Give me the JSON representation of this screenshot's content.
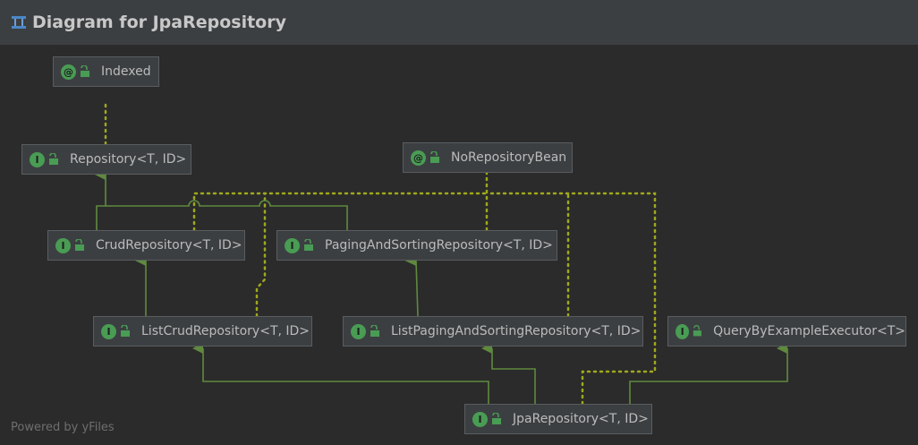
{
  "title": "Diagram for JpaRepository",
  "footer": "Powered by yFiles",
  "colors": {
    "edge": "#5f8a3e",
    "annotation_edge": "#a0a81c",
    "icon": "#499c54"
  },
  "nodes": {
    "indexed": {
      "kind": "@",
      "label": "Indexed"
    },
    "repository": {
      "kind": "I",
      "label": "Repository<T, ID>"
    },
    "no_repository_bean": {
      "kind": "@",
      "label": "NoRepositoryBean"
    },
    "crud_repository": {
      "kind": "I",
      "label": "CrudRepository<T, ID>"
    },
    "paging_and_sorting_repository": {
      "kind": "I",
      "label": "PagingAndSortingRepository<T, ID>"
    },
    "list_crud_repository": {
      "kind": "I",
      "label": "ListCrudRepository<T, ID>"
    },
    "list_paging_and_sorting_repository": {
      "kind": "I",
      "label": "ListPagingAndSortingRepository<T, ID>"
    },
    "query_by_example_executor": {
      "kind": "I",
      "label": "QueryByExampleExecutor<T>"
    },
    "jpa_repository": {
      "kind": "I",
      "label": "JpaRepository<T, ID>"
    }
  }
}
